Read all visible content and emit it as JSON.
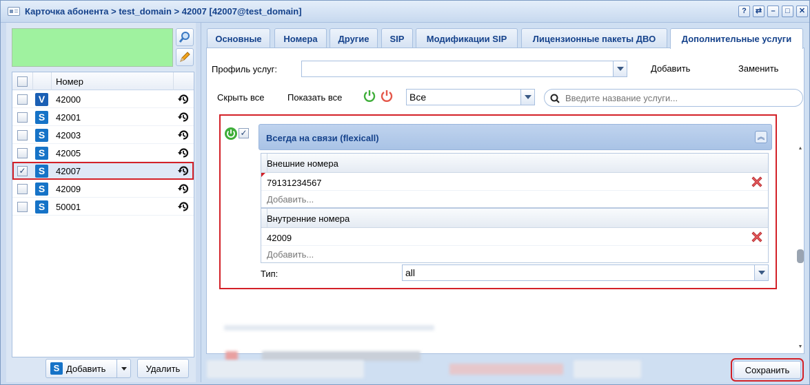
{
  "window": {
    "title": "Карточка абонента > test_domain > 42007 [42007@test_domain]",
    "buttons": {
      "help": "?",
      "refresh": "⇄",
      "minimize": "–",
      "maximize": "□",
      "close": "✕"
    }
  },
  "left": {
    "grid": {
      "header": {
        "number": "Номер"
      },
      "rows": [
        {
          "number": "42000",
          "badge": "V",
          "checked": false,
          "selected": false
        },
        {
          "number": "42001",
          "badge": "S",
          "checked": false,
          "selected": false
        },
        {
          "number": "42003",
          "badge": "S",
          "checked": false,
          "selected": false
        },
        {
          "number": "42005",
          "badge": "S",
          "checked": false,
          "selected": false
        },
        {
          "number": "42007",
          "badge": "S",
          "checked": true,
          "selected": true
        },
        {
          "number": "42009",
          "badge": "S",
          "checked": false,
          "selected": false
        },
        {
          "number": "50001",
          "badge": "S",
          "checked": false,
          "selected": false
        }
      ]
    },
    "add_label": "Добавить",
    "add_badge": "S",
    "delete_label": "Удалить"
  },
  "tabs": [
    {
      "label": "Основные"
    },
    {
      "label": "Номера"
    },
    {
      "label": "Другие"
    },
    {
      "label": "SIP"
    },
    {
      "label": "Модификации SIP"
    },
    {
      "label": "Лицензионные пакеты ДВО"
    },
    {
      "label": "Дополнительные услуги"
    }
  ],
  "toolbar": {
    "profile_label": "Профиль услуг:",
    "profile_value": "",
    "add_label": "Добавить",
    "replace_label": "Заменить",
    "hide_all": "Скрыть все",
    "show_all": "Показать все",
    "filter_value": "Все",
    "search_placeholder": "Введите название услуги..."
  },
  "service": {
    "title": "Всегда на связи (flexicall)",
    "enabled": true,
    "external": {
      "header": "Внешние номера",
      "values": [
        "79131234567"
      ],
      "add": "Добавить..."
    },
    "internal": {
      "header": "Внутренние номера",
      "values": [
        "42009"
      ],
      "add": "Добавить..."
    },
    "type_label": "Тип:",
    "type_value": "all"
  },
  "footer": {
    "save_label": "Сохранить"
  },
  "colors": {
    "accent": "#15428b",
    "highlight": "#d32027",
    "green": "#9ff29f"
  }
}
